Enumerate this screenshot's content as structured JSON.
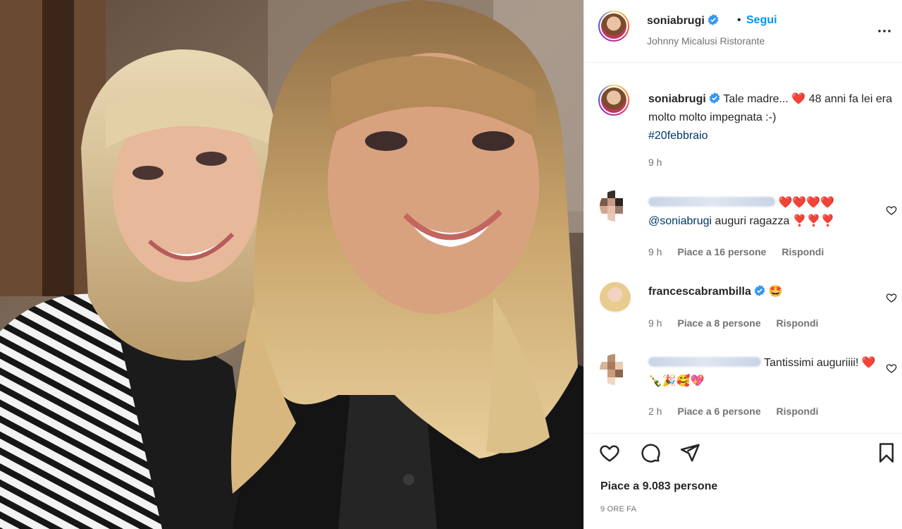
{
  "post": {
    "username": "soniabrugi",
    "follow_label": "Segui",
    "separator": "•",
    "location": "Johnny Micalusi Ristorante",
    "caption": {
      "username": "soniabrugi",
      "text_before_emoji": "Tale madre...",
      "emoji": "❤️",
      "text_after_emoji": "48 anni fa lei era molto molto impegnata :-)",
      "hashtag": "#20febbraio",
      "time": "9 h"
    },
    "comments": [
      {
        "username_hidden": true,
        "emojis": "❤️❤️❤️❤️",
        "mention": "@soniabrugi",
        "text": "auguri ragazza",
        "trailing_emojis": "❣️❣️❣️",
        "time": "9 h",
        "likes": "Piace a 16 persone",
        "reply": "Rispondi"
      },
      {
        "username": "francescabrambilla",
        "emojis": "🤩",
        "time": "9 h",
        "likes": "Piace a 8 persone",
        "reply": "Rispondi"
      },
      {
        "username_hidden": true,
        "text": "Tantissimi auguriiii!",
        "trailing_emojis": "❤️🍾🎉🥰💖",
        "time": "2 h",
        "likes": "Piace a 6 persone",
        "reply": "Rispondi"
      }
    ],
    "likes_text": "Piace a 9.083 persone",
    "date": "9 ORE FA"
  },
  "icons": {
    "verified": "verified-badge-icon",
    "more": "more-options-icon",
    "comment_like": "heart-outline-icon",
    "like": "heart-icon",
    "comment": "comment-bubble-icon",
    "share": "paper-plane-icon",
    "save": "bookmark-icon"
  },
  "colors": {
    "follow": "#0095f6",
    "link": "#00376b",
    "secondary_text": "#737373",
    "verified": "#3897f0"
  }
}
